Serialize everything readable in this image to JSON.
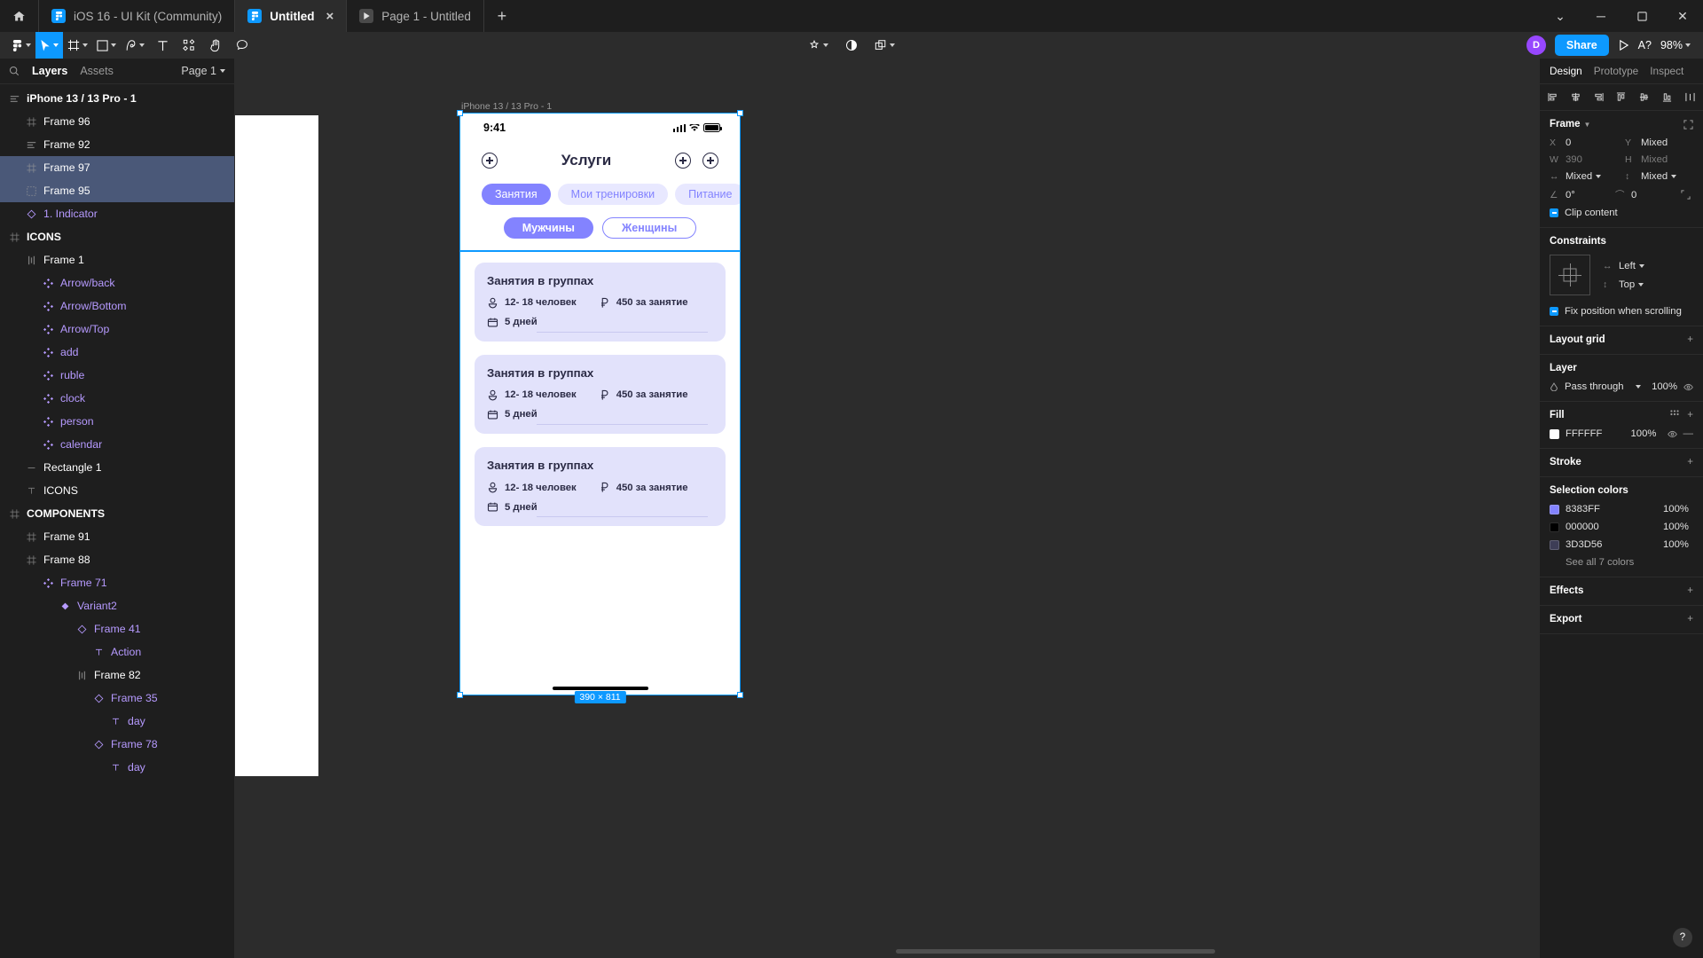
{
  "window": {
    "tabs": [
      {
        "title": "iOS 16 - UI Kit (Community)",
        "active": false,
        "icon": "figma-file-icon",
        "closable": false
      },
      {
        "title": "Untitled",
        "active": true,
        "icon": "figma-file-icon",
        "closable": true,
        "close_label": "×"
      },
      {
        "title": "Page 1 - Untitled",
        "active": false,
        "icon": "prototype-play-icon",
        "closable": false
      }
    ],
    "new_tab_label": "+",
    "controls": {
      "chevron": "⌄",
      "minimize": "─",
      "maximize": "❐",
      "close": "✕"
    }
  },
  "toolbar": {
    "menu_label": "figma-menu",
    "tools": [
      {
        "name": "move-tool",
        "selected": true,
        "has_caret": true
      },
      {
        "name": "frame-tool",
        "selected": false,
        "has_caret": true
      },
      {
        "name": "shape-tool",
        "selected": false,
        "has_caret": true
      },
      {
        "name": "pen-tool",
        "selected": false,
        "has_caret": true
      },
      {
        "name": "text-tool",
        "selected": false,
        "has_caret": false
      },
      {
        "name": "components-tool",
        "selected": false,
        "has_caret": false
      },
      {
        "name": "hand-tool",
        "selected": false,
        "has_caret": false
      },
      {
        "name": "comment-tool",
        "selected": false,
        "has_caret": false
      }
    ],
    "center_tools": [
      {
        "name": "actions-tool",
        "has_caret": true
      },
      {
        "name": "appearance-tool",
        "has_caret": false
      },
      {
        "name": "libraries-tool",
        "has_caret": true
      }
    ],
    "avatar_initial": "D",
    "share_label": "Share",
    "present_label": "present-icon",
    "assistant_label": "A?",
    "zoom_level": "98%"
  },
  "left_panel": {
    "search_label": "search-icon",
    "tabs": [
      {
        "label": "Layers",
        "active": true
      },
      {
        "label": "Assets",
        "active": false
      }
    ],
    "page_selector": "Page 1",
    "layers": [
      {
        "label": "iPhone 13 / 13 Pro - 1",
        "indent": 0,
        "icon": "autolayout-icon",
        "type": "frame-bold",
        "selected": false
      },
      {
        "label": "Frame 96",
        "indent": 1,
        "icon": "frame-icon",
        "type": "frame",
        "selected": false
      },
      {
        "label": "Frame 92",
        "indent": 1,
        "icon": "autolayout-icon",
        "type": "frame",
        "selected": false
      },
      {
        "label": "Frame 97",
        "indent": 1,
        "icon": "frame-icon",
        "type": "frame",
        "selected": true
      },
      {
        "label": "Frame 95",
        "indent": 1,
        "icon": "group-icon",
        "type": "frame",
        "selected": true
      },
      {
        "label": "1. Indicator",
        "indent": 1,
        "icon": "component-instance-icon",
        "type": "component",
        "selected": false
      },
      {
        "label": "ICONS",
        "indent": 0,
        "icon": "frame-icon",
        "type": "frame-bold",
        "selected": false
      },
      {
        "label": "Frame 1",
        "indent": 1,
        "icon": "autolayout-h-icon",
        "type": "frame",
        "selected": false
      },
      {
        "label": "Arrow/back",
        "indent": 2,
        "icon": "component-icon",
        "type": "component",
        "selected": false
      },
      {
        "label": "Arrow/Bottom",
        "indent": 2,
        "icon": "component-icon",
        "type": "component",
        "selected": false
      },
      {
        "label": "Arrow/Top",
        "indent": 2,
        "icon": "component-icon",
        "type": "component",
        "selected": false
      },
      {
        "label": "add",
        "indent": 2,
        "icon": "component-icon",
        "type": "component",
        "selected": false
      },
      {
        "label": "ruble",
        "indent": 2,
        "icon": "component-icon",
        "type": "component",
        "selected": false
      },
      {
        "label": "clock",
        "indent": 2,
        "icon": "component-icon",
        "type": "component",
        "selected": false
      },
      {
        "label": "person",
        "indent": 2,
        "icon": "component-icon",
        "type": "component",
        "selected": false
      },
      {
        "label": "calendar",
        "indent": 2,
        "icon": "component-icon",
        "type": "component",
        "selected": false
      },
      {
        "label": "Rectangle 1",
        "indent": 1,
        "icon": "line-icon",
        "type": "frame",
        "selected": false
      },
      {
        "label": "ICONS",
        "indent": 1,
        "icon": "text-icon",
        "type": "frame",
        "selected": false
      },
      {
        "label": "COMPONENTS",
        "indent": 0,
        "icon": "frame-icon",
        "type": "frame-bold",
        "selected": false
      },
      {
        "label": "Frame 91",
        "indent": 1,
        "icon": "frame-icon",
        "type": "frame",
        "selected": false
      },
      {
        "label": "Frame 88",
        "indent": 1,
        "icon": "frame-icon",
        "type": "frame",
        "selected": false
      },
      {
        "label": "Frame 71",
        "indent": 2,
        "icon": "component-icon",
        "type": "component",
        "selected": false
      },
      {
        "label": "Variant2",
        "indent": 3,
        "icon": "variant-icon",
        "type": "component",
        "selected": false
      },
      {
        "label": "Frame 41",
        "indent": 4,
        "icon": "component-instance-icon",
        "type": "component",
        "selected": false
      },
      {
        "label": "Action",
        "indent": 5,
        "icon": "text-icon",
        "type": "component",
        "selected": false
      },
      {
        "label": "Frame 82",
        "indent": 4,
        "icon": "autolayout-h-icon",
        "type": "frame",
        "selected": false
      },
      {
        "label": "Frame 35",
        "indent": 5,
        "icon": "component-instance-icon",
        "type": "component",
        "selected": false
      },
      {
        "label": "day",
        "indent": 6,
        "icon": "text-icon",
        "type": "component",
        "selected": false
      },
      {
        "label": "Frame 78",
        "indent": 5,
        "icon": "component-instance-icon",
        "type": "component",
        "selected": false
      },
      {
        "label": "day",
        "indent": 6,
        "icon": "text-icon",
        "type": "component",
        "selected": false
      }
    ]
  },
  "canvas": {
    "frame_label": "iPhone 13 / 13 Pro - 1",
    "dimensions_badge": "390 × 811",
    "phone": {
      "status_bar": {
        "time": "9:41",
        "signal": "cellular-icon",
        "wifi": "wifi-icon",
        "battery": "battery-icon"
      },
      "nav": {
        "left_icon": "add-circle-icon",
        "title": "Услуги",
        "right_icons": [
          "add-circle-icon",
          "add-circle-icon"
        ]
      },
      "chips": [
        {
          "label": "Занятия",
          "active": true
        },
        {
          "label": "Мои тренировки",
          "active": false
        },
        {
          "label": "Питание",
          "active": false
        }
      ],
      "gender": [
        {
          "label": "Мужчины",
          "active": true
        },
        {
          "label": "Женщины",
          "active": false
        }
      ],
      "cards": [
        {
          "title": "Занятия в группах",
          "people": "12- 18 человек",
          "price": "450 за занятие",
          "days": "5 дней"
        },
        {
          "title": "Занятия в группах",
          "people": "12- 18 человек",
          "price": "450 за занятие",
          "days": "5 дней"
        },
        {
          "title": "Занятия в группах",
          "people": "12- 18 человек",
          "price": "450 за занятие",
          "days": "5 дней"
        }
      ]
    }
  },
  "right_panel": {
    "tabs": [
      {
        "label": "Design",
        "active": true
      },
      {
        "label": "Prototype",
        "active": false
      },
      {
        "label": "Inspect",
        "active": false
      }
    ],
    "align_icons": [
      "align-left-icon",
      "align-center-h-icon",
      "align-right-icon",
      "align-top-icon",
      "align-center-v-icon",
      "align-bottom-icon",
      "distribute-icon"
    ],
    "frame": {
      "title": "Frame",
      "x_key": "X",
      "x_value": "0",
      "y_key": "Y",
      "y_value": "Mixed",
      "w_key": "W",
      "w_value": "390",
      "h_key": "H",
      "h_value": "Mixed",
      "hconstraint_key": "↔",
      "hconstraint_value": "Mixed",
      "vconstraint_key": "↕",
      "vconstraint_value": "Mixed",
      "rotation_key": "∠",
      "rotation_value": "0°",
      "corner_key": "⌒",
      "corner_value": "0",
      "clip_content": "Clip content"
    },
    "constraints": {
      "title": "Constraints",
      "horizontal": "Left",
      "vertical": "Top",
      "fix_position": "Fix position when scrolling"
    },
    "layout_grid": {
      "title": "Layout grid",
      "add": "+"
    },
    "layer": {
      "title": "Layer",
      "blend_mode": "Pass through",
      "opacity": "100%"
    },
    "fill": {
      "title": "Fill",
      "hex": "FFFFFF",
      "opacity": "100%",
      "color": "#FFFFFF"
    },
    "stroke": {
      "title": "Stroke",
      "add": "+"
    },
    "selection_colors": {
      "title": "Selection colors",
      "items": [
        {
          "hex": "8383FF",
          "opacity": "100%",
          "color": "#8383FF"
        },
        {
          "hex": "000000",
          "opacity": "100%",
          "color": "#000000"
        },
        {
          "hex": "3D3D56",
          "opacity": "100%",
          "color": "#3D3D56"
        }
      ],
      "see_all": "See all 7 colors"
    },
    "effects": {
      "title": "Effects",
      "add": "+"
    },
    "export": {
      "title": "Export",
      "add": "+"
    },
    "help_label": "?"
  }
}
